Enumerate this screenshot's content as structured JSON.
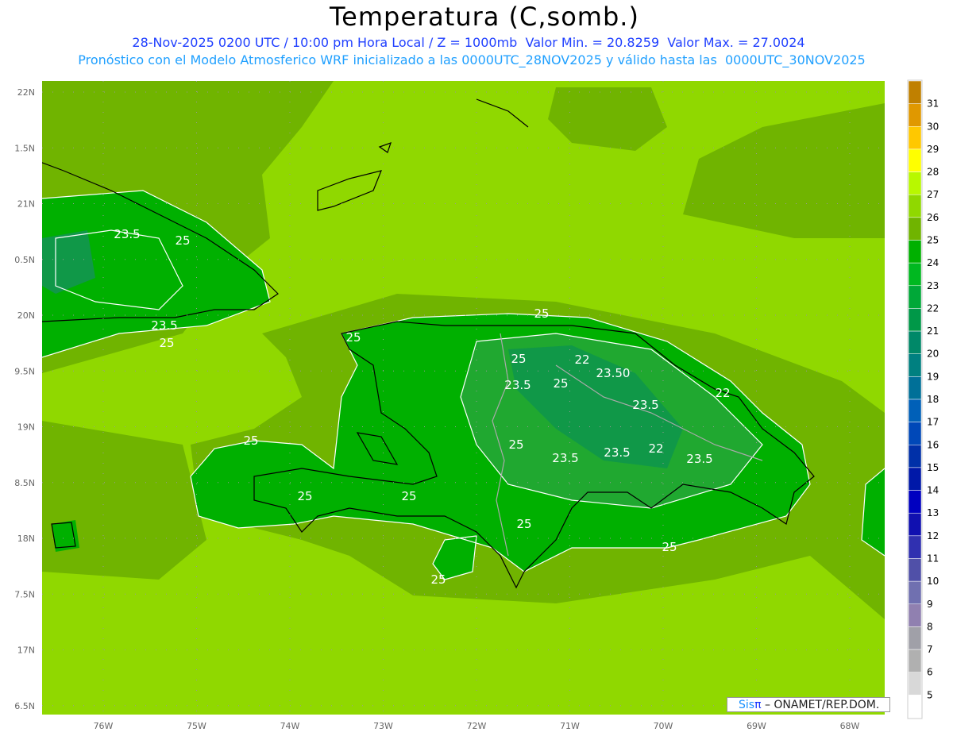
{
  "header": {
    "title": "Temperatura (C,somb.)",
    "line1": "28-Nov-2025 0200 UTC / 10:00 pm Hora Local / Z = 1000mb  Valor Min. = 20.8259  Valor Max. = 27.0024",
    "line2": "Pronóstico con el Modelo Atmosferico WRF inicializado a las 0000UTC_28NOV2025 y válido hasta las  0000UTC_30NOV2025"
  },
  "axes": {
    "lat_labels": [
      "22N",
      "1.5N",
      "21N",
      "0.5N",
      "20N",
      "9.5N",
      "19N",
      "8.5N",
      "18N",
      "7.5N",
      "17N",
      "6.5N"
    ],
    "lat_values": [
      22,
      21.5,
      21,
      20.5,
      20,
      19.5,
      19,
      18.5,
      18,
      17.5,
      17,
      16.5
    ],
    "lon_labels": [
      "76W",
      "75W",
      "74W",
      "73W",
      "72W",
      "71W",
      "70W",
      "69W",
      "68W"
    ],
    "lon_values": [
      -76,
      -75,
      -74,
      -73,
      -72,
      -71,
      -70,
      -69,
      -68
    ]
  },
  "contour_labels": [
    "23.5",
    "25",
    "23.5",
    "25",
    "25",
    "25",
    "25",
    "22",
    "23.50",
    "23.5",
    "25",
    "23.5",
    "22",
    "25",
    "23.5",
    "23.5",
    "22",
    "23.5",
    "25",
    "25",
    "25",
    "25",
    "25",
    "25"
  ],
  "colorbar": {
    "labels": [
      "31",
      "30",
      "29",
      "28",
      "27",
      "26",
      "25",
      "24",
      "23",
      "22",
      "21",
      "20",
      "19",
      "18",
      "17",
      "16",
      "15",
      "14",
      "13",
      "12",
      "11",
      "10",
      "9",
      "8",
      "7",
      "6",
      "5"
    ],
    "colors": [
      "#c08000",
      "#e09800",
      "#ffc800",
      "#ffff00",
      "#b8f800",
      "#90d800",
      "#70b400",
      "#00b000",
      "#00b820",
      "#00a838",
      "#009848",
      "#008868",
      "#008080",
      "#007098",
      "#0060b8",
      "#0048b8",
      "#0030a8",
      "#0018a8",
      "#0000c0",
      "#1010b0",
      "#3030b0",
      "#5050a8",
      "#7070b0",
      "#9080b0",
      "#a0a0a8",
      "#b0b0b0",
      "#d8d8d8",
      "#ffffff"
    ]
  },
  "field_colors": {
    "t26": "#90d800",
    "t25": "#70b400",
    "t24": "#00b000",
    "t23": "#20a830",
    "t22": "#109848"
  },
  "credit": {
    "sis": "Sis",
    "pi": "π",
    "rest": " – ONAMET/REP.DOM."
  }
}
